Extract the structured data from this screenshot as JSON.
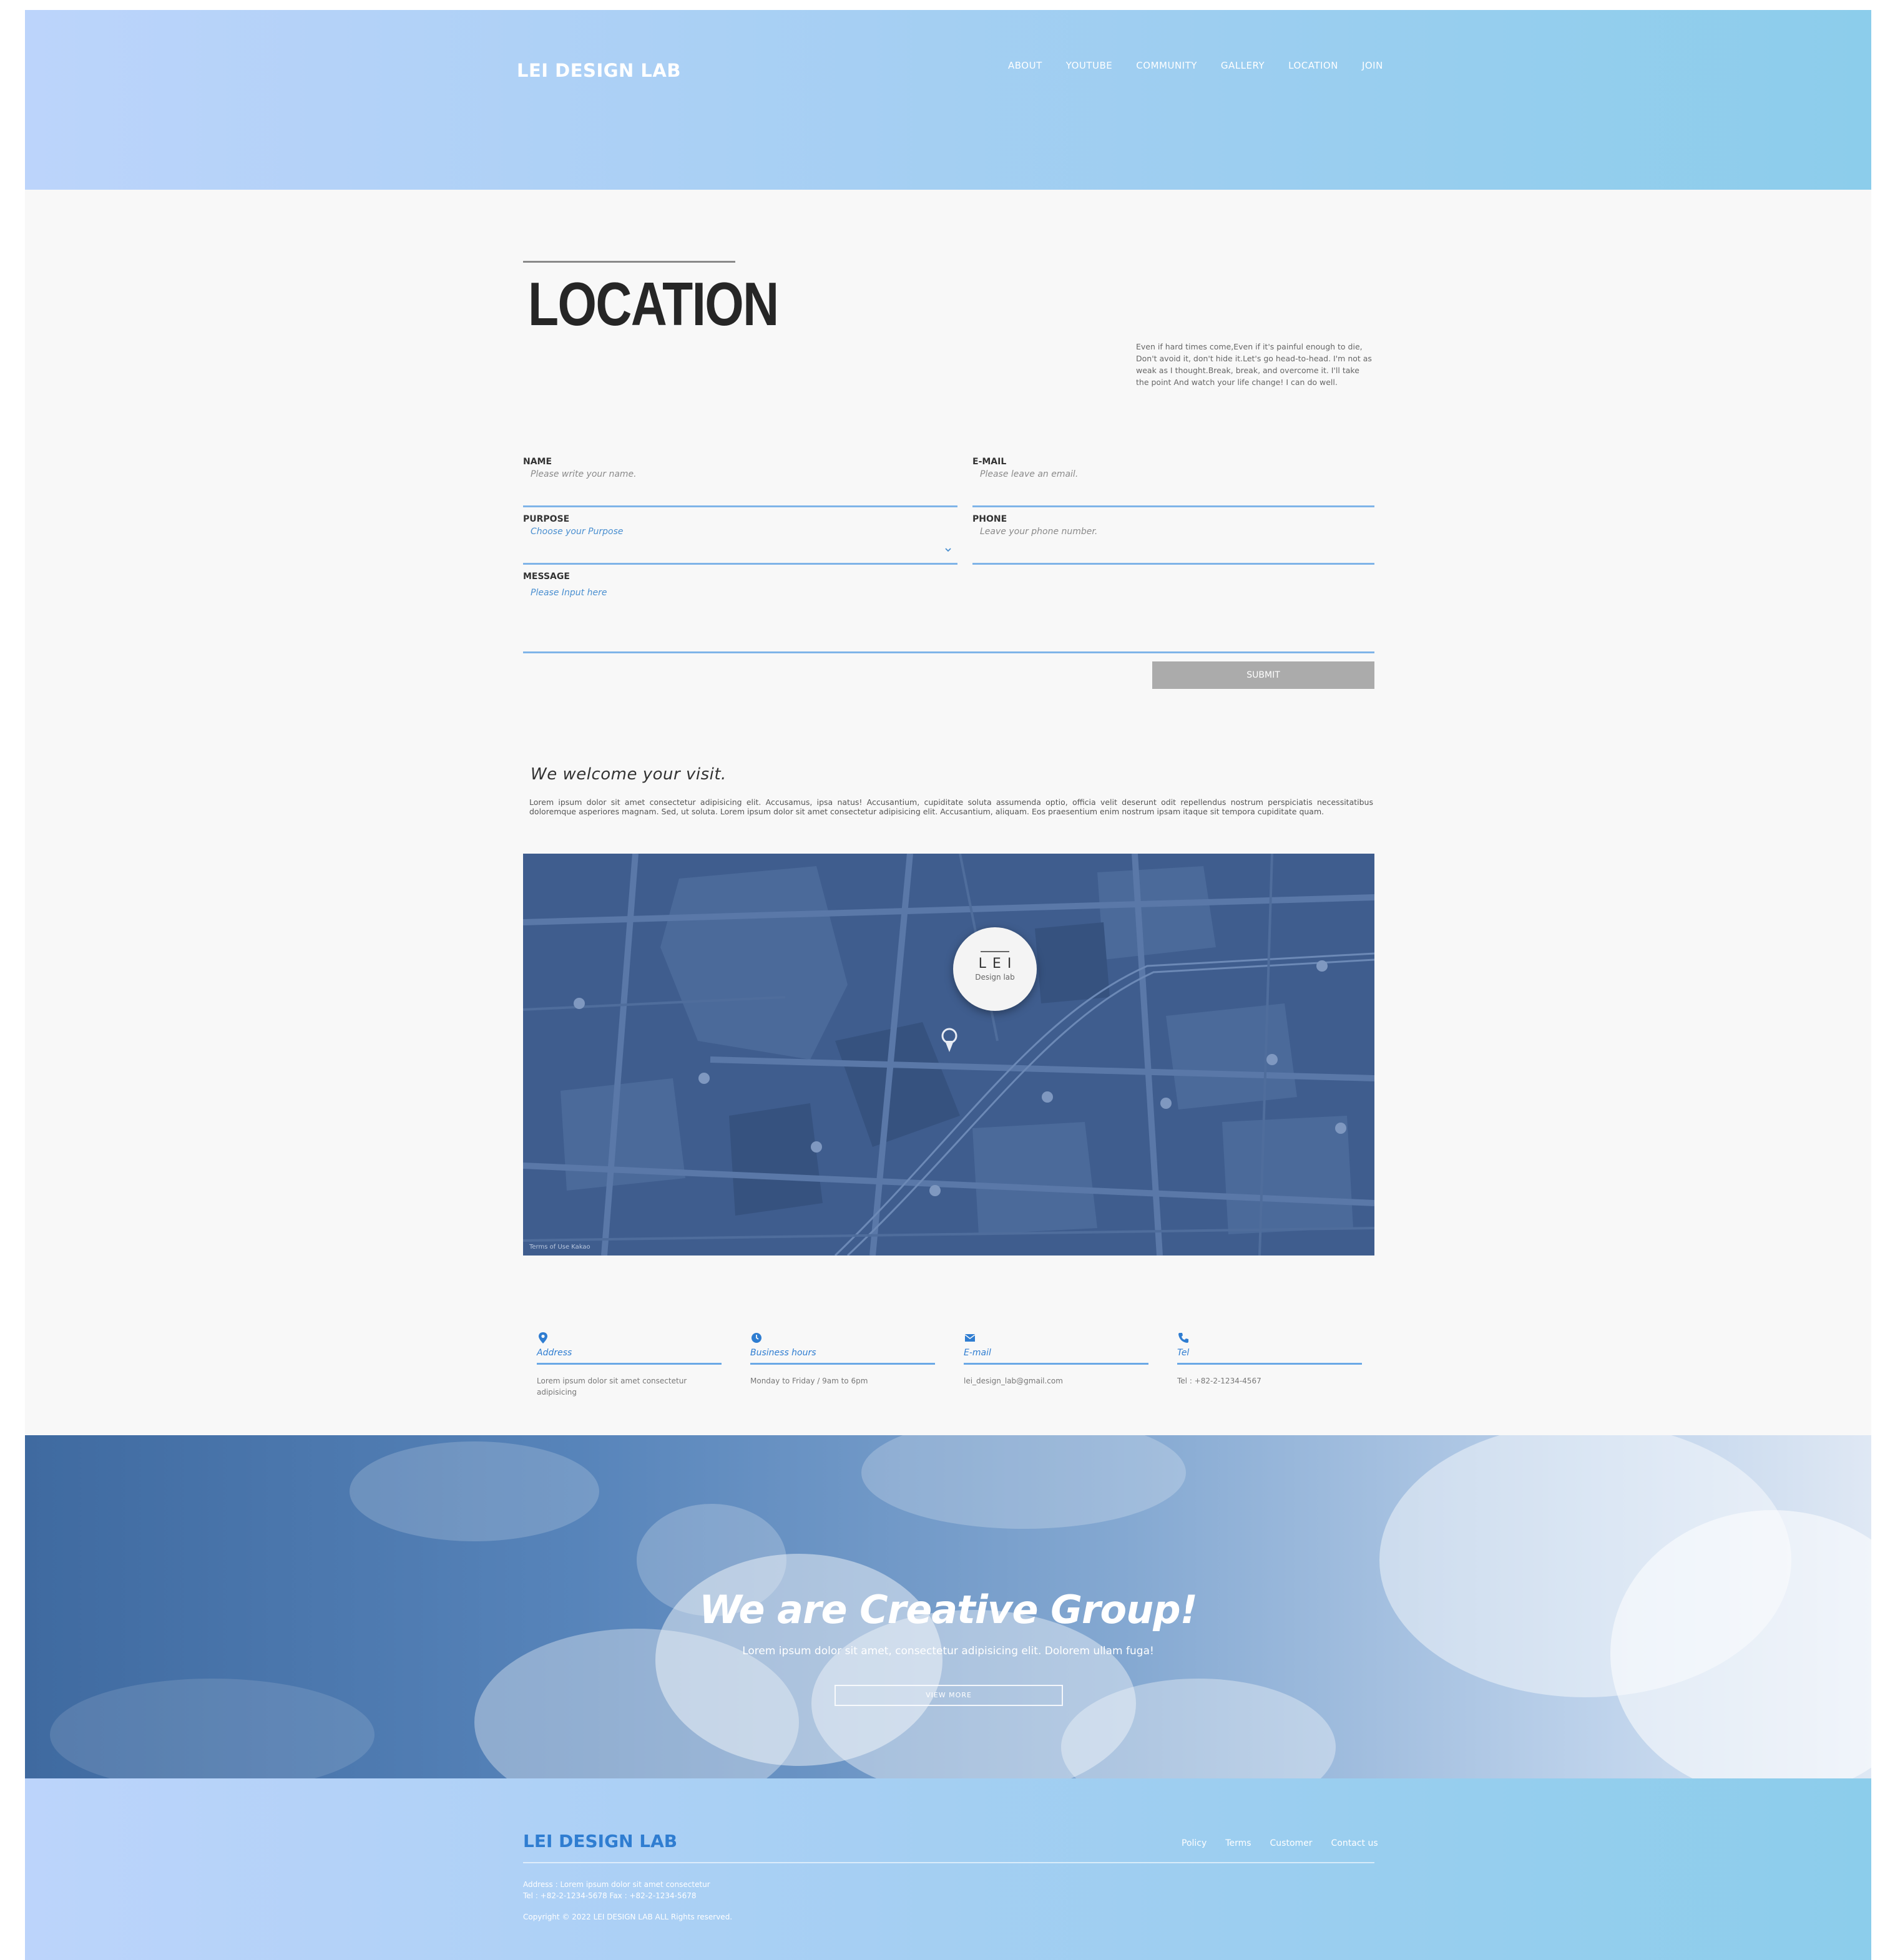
{
  "header": {
    "logo": "LEI DESIGN LAB",
    "nav": [
      "ABOUT",
      "YOUTUBE",
      "COMMUNITY",
      "GALLERY",
      "LOCATION",
      "JOIN"
    ]
  },
  "location": {
    "title": "LOCATION",
    "intro": "Even if hard times come,Even if it's painful enough to die, Don't avoid it, don't hide it.Let's go head-to-head. I'm not as weak as I thought.Break, break, and overcome it. I'll take the point And watch your life change! I can do well.",
    "form": {
      "name_label": "NAME",
      "name_placeholder": "Please write your name.",
      "email_label": "E-MAIL",
      "email_placeholder": "Please leave an email.",
      "purpose_label": "PURPOSE",
      "purpose_selected": "Choose your Purpose",
      "phone_label": "PHONE",
      "phone_placeholder": "Leave your phone number.",
      "message_label": "MESSAGE",
      "message_placeholder": "Please Input here",
      "submit_label": "SUBMIT"
    }
  },
  "visit": {
    "heading": "We welcome your visit.",
    "body": "Lorem ipsum dolor sit amet consectetur adipisicing elit. Accusamus, ipsa natus! Accusantium, cupiditate soluta assumenda optio, officia velit deserunt odit repellendus nostrum perspiciatis necessitatibus doloremque asperiores magnam. Sed, ut soluta. Lorem ipsum dolor sit amet consectetur adipisicing elit. Accusantium, aliquam. Eos praesentium enim nostrum ipsam itaque sit tempora cupiditate quam."
  },
  "map": {
    "marker_title": "LEI",
    "marker_subtitle": "Design lab",
    "attribution": "Terms of Use  Kakao"
  },
  "info_cards": [
    {
      "icon": "map-marker-icon",
      "label": "Address",
      "value": "Lorem ipsum dolor sit amet consectetur adipisicing"
    },
    {
      "icon": "clock-icon",
      "label": "Business hours",
      "value": "Monday to Friday / 9am to 6pm"
    },
    {
      "icon": "envelope-icon",
      "label": "E-mail",
      "value": "lei_design_lab@gmail.com"
    },
    {
      "icon": "phone-icon",
      "label": "Tel",
      "value": "Tel : +82-2-1234-4567"
    }
  ],
  "banner": {
    "title": "We are Creative Group!",
    "subtitle": "Lorem ipsum dolor sit amet, consectetur adipisicing elit. Dolorem ullam fuga!",
    "button_label": "VIEW MORE"
  },
  "footer": {
    "logo": "LEI DESIGN LAB",
    "links": [
      "Policy",
      "Terms",
      "Customer",
      "Contact us"
    ],
    "address": "Address : Lorem ipsum dolor sit amet consectetur",
    "tel": "Tel : +82-2-1234-5678  Fax : +82-2-1234-5678",
    "copyright": "Copyright © 2022 LEI DESIGN LAB ALL Rights reserved."
  },
  "colors": {
    "accent": "#2f7dd1",
    "header_gradient_start": "#bcd4fb",
    "header_gradient_end": "#8ccdeb",
    "map_tint": "#3f5d8e",
    "submit_bg": "#ababab"
  }
}
